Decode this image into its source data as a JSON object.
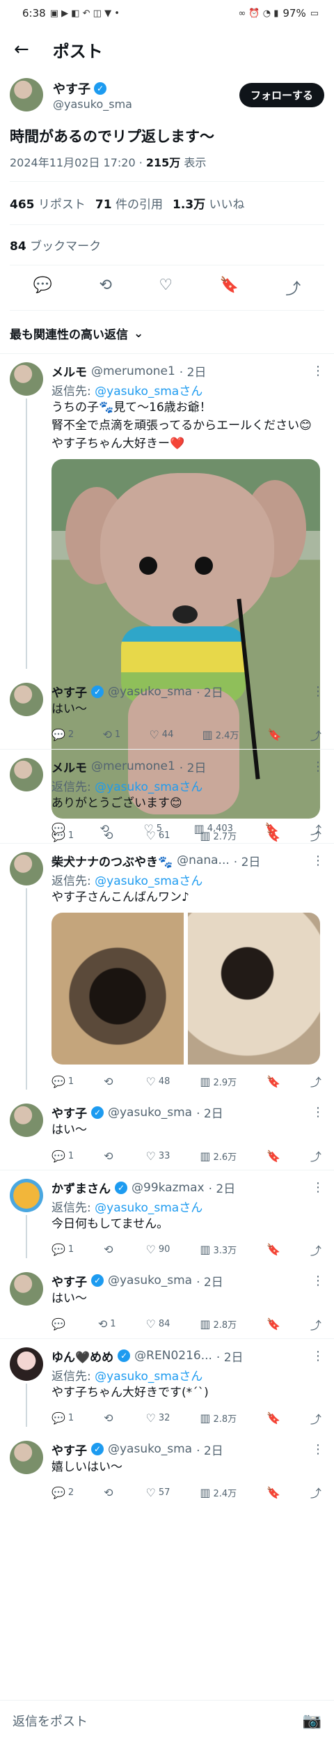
{
  "status_bar": {
    "time": "6:38",
    "battery": "97%"
  },
  "nav": {
    "title": "ポスト"
  },
  "main_post": {
    "author_name": "やす子",
    "author_handle": "@yasuko_sma",
    "follow_label": "フォローする",
    "text": "時間があるのでリプ返します〜",
    "date": "2024年11月02日 17:20",
    "views_count": "215万",
    "views_label": "表示",
    "stats": {
      "reposts_count": "465",
      "reposts_label": "リポスト",
      "quotes_count": "71",
      "quotes_label": "件の引用",
      "likes_count": "1.3万",
      "likes_label": "いいね",
      "bookmarks_count": "84",
      "bookmarks_label": "ブックマーク"
    }
  },
  "sort_label": "最も関連性の高い返信",
  "replies": [
    {
      "name": "メルモ",
      "handle": "@merumone1",
      "time": "2日",
      "reply_to_label": "返信先:",
      "reply_to_mention": "@yasuko_smaさん",
      "text_1": "うちの子🐾見て〜16歳お爺！",
      "text_2": "腎不全で点滴を頑張ってるからエールください😊",
      "text_3": "やす子ちゃん大好きー❤️",
      "replies": "1",
      "reposts": "",
      "likes": "61",
      "views": "2.7万"
    },
    {
      "name": "やす子",
      "handle": "@yasuko_sma",
      "time": "2日",
      "text_1": "はい〜",
      "replies": "2",
      "reposts": "1",
      "likes": "44",
      "views": "2.4万"
    },
    {
      "name": "メルモ",
      "handle": "@merumone1",
      "time": "2日",
      "reply_to_label": "返信先:",
      "reply_to_mention": "@yasuko_smaさん",
      "text_1": "ありがとうございます😊",
      "replies": "",
      "reposts": "",
      "likes": "5",
      "views": "4,403"
    },
    {
      "name": "柴犬ナナのつぶやき🐾",
      "handle": "@nana...",
      "time": "2日",
      "reply_to_label": "返信先:",
      "reply_to_mention": "@yasuko_smaさん",
      "text_1": "やす子さんこんばんワン♪",
      "replies": "1",
      "reposts": "",
      "likes": "48",
      "views": "2.9万"
    },
    {
      "name": "やす子",
      "handle": "@yasuko_sma",
      "time": "2日",
      "text_1": "はい〜",
      "replies": "1",
      "reposts": "",
      "likes": "33",
      "views": "2.6万"
    },
    {
      "name": "かずまさん",
      "handle": "@99kazmax",
      "time": "2日",
      "reply_to_label": "返信先:",
      "reply_to_mention": "@yasuko_smaさん",
      "text_1": "今日何もしてません。",
      "replies": "1",
      "reposts": "",
      "likes": "90",
      "views": "3.3万"
    },
    {
      "name": "やす子",
      "handle": "@yasuko_sma",
      "time": "2日",
      "text_1": "はい〜",
      "replies": "",
      "reposts": "1",
      "likes": "84",
      "views": "2.8万"
    },
    {
      "name": "ゆん🖤めめ",
      "handle": "@REN0216...",
      "time": "2日",
      "reply_to_label": "返信先:",
      "reply_to_mention": "@yasuko_smaさん",
      "text_1": "やす子ちゃん大好きです(*´`)",
      "replies": "1",
      "reposts": "",
      "likes": "32",
      "views": "2.8万"
    },
    {
      "name": "やす子",
      "handle": "@yasuko_sma",
      "time": "2日",
      "text_1": "嬉しいはい〜",
      "replies": "2",
      "reposts": "",
      "likes": "57",
      "views": "2.4万"
    }
  ],
  "reply_input": {
    "placeholder": "返信をポスト"
  }
}
